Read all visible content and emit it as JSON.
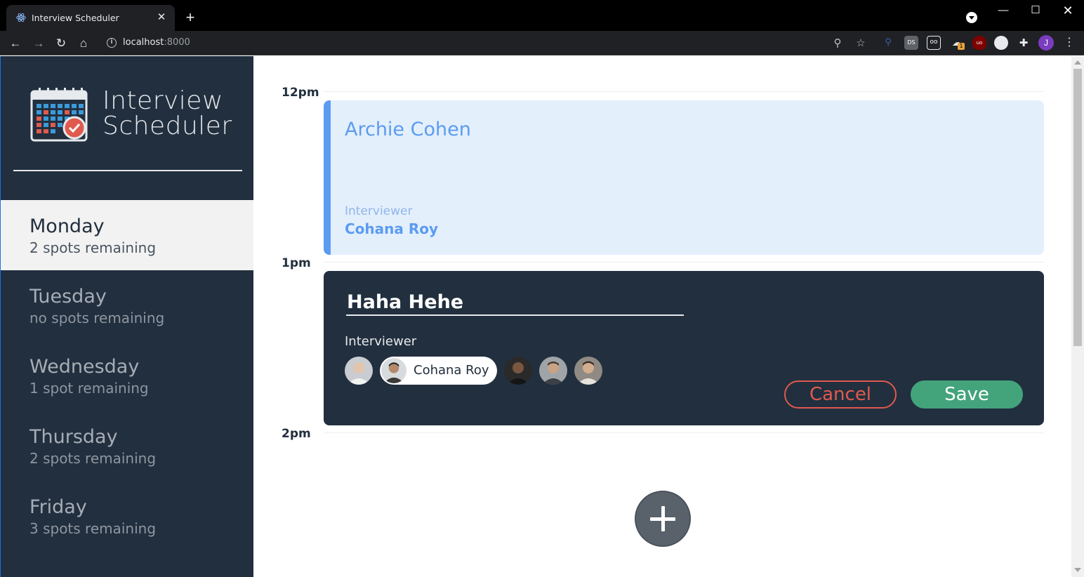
{
  "browser": {
    "tab_title": "Interview Scheduler",
    "url_host": "localhost",
    "url_port": ":8000",
    "profile_initial": "J",
    "extension_badge": "1"
  },
  "app": {
    "logo_line1": "Interview",
    "logo_line2": "Scheduler"
  },
  "days": [
    {
      "name": "Monday",
      "spots": "2 spots remaining",
      "selected": true
    },
    {
      "name": "Tuesday",
      "spots": "no spots remaining",
      "selected": false
    },
    {
      "name": "Wednesday",
      "spots": "1 spot remaining",
      "selected": false
    },
    {
      "name": "Thursday",
      "spots": "2 spots remaining",
      "selected": false
    },
    {
      "name": "Friday",
      "spots": "3 spots remaining",
      "selected": false
    }
  ],
  "schedule": {
    "times": [
      "12pm",
      "1pm",
      "2pm"
    ],
    "booked": {
      "student": "Archie Cohen",
      "interviewer_label": "Interviewer",
      "interviewer": "Cohana Roy"
    },
    "form": {
      "student_value": "Haha Hehe",
      "interviewer_label": "Interviewer",
      "selected_interviewer": "Cohana Roy",
      "cancel_label": "Cancel",
      "save_label": "Save"
    }
  },
  "colors": {
    "sidebar": "#222f3e",
    "show_accent": "#5b9cf0",
    "cancel": "#e05a4e",
    "save": "#43a47c"
  }
}
